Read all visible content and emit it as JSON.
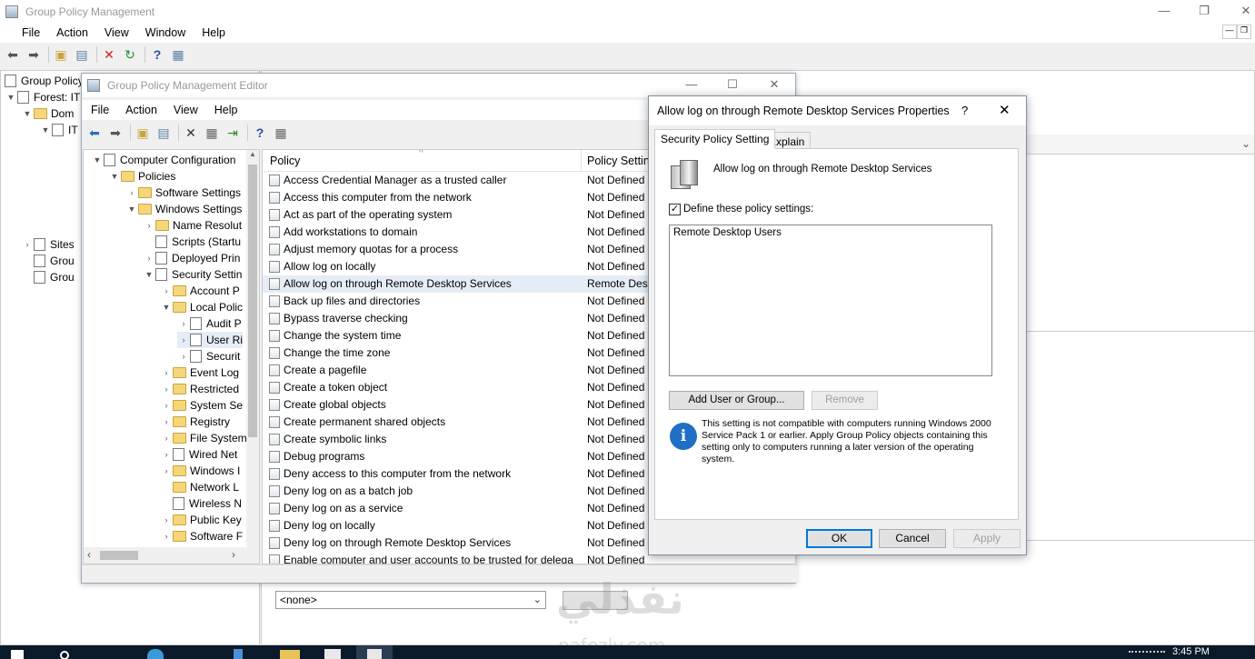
{
  "gpm": {
    "title": "Group Policy Management",
    "menu": [
      "File",
      "Action",
      "View",
      "Window",
      "Help"
    ],
    "tree": [
      "Group Policy",
      "Forest: IT",
      "Dom",
      "IT",
      "Sites",
      "Grou",
      "Grou"
    ]
  },
  "editor": {
    "title": "Group Policy Management Editor",
    "menu": [
      "File",
      "Action",
      "View",
      "Help"
    ],
    "tree": [
      {
        "label": "Computer Configuration",
        "indent": 0,
        "arrow": "▼",
        "kind": "doc"
      },
      {
        "label": "Policies",
        "indent": 1,
        "arrow": "▼",
        "kind": "fold"
      },
      {
        "label": "Software Settings",
        "indent": 2,
        "arrow": "›",
        "kind": "fold"
      },
      {
        "label": "Windows Settings",
        "indent": 2,
        "arrow": "▼",
        "kind": "fold"
      },
      {
        "label": "Name Resolut",
        "indent": 3,
        "arrow": "›",
        "kind": "fold"
      },
      {
        "label": "Scripts (Startu",
        "indent": 3,
        "arrow": "",
        "kind": "doc"
      },
      {
        "label": "Deployed Prin",
        "indent": 3,
        "arrow": "›",
        "kind": "doc"
      },
      {
        "label": "Security Settin",
        "indent": 3,
        "arrow": "▼",
        "kind": "doc"
      },
      {
        "label": "Account P",
        "indent": 4,
        "arrow": "›",
        "kind": "fold"
      },
      {
        "label": "Local Polic",
        "indent": 4,
        "arrow": "▼",
        "kind": "fold"
      },
      {
        "label": "Audit P",
        "indent": 5,
        "arrow": "›",
        "kind": "doc"
      },
      {
        "label": "User Ri",
        "indent": 5,
        "arrow": "›",
        "kind": "doc",
        "selected": true
      },
      {
        "label": "Securit",
        "indent": 5,
        "arrow": "›",
        "kind": "doc"
      },
      {
        "label": "Event Log",
        "indent": 4,
        "arrow": "›",
        "kind": "fold"
      },
      {
        "label": "Restricted",
        "indent": 4,
        "arrow": "›",
        "kind": "fold"
      },
      {
        "label": "System Se",
        "indent": 4,
        "arrow": "›",
        "kind": "fold"
      },
      {
        "label": "Registry",
        "indent": 4,
        "arrow": "›",
        "kind": "fold"
      },
      {
        "label": "File System",
        "indent": 4,
        "arrow": "›",
        "kind": "fold"
      },
      {
        "label": "Wired Net",
        "indent": 4,
        "arrow": "›",
        "kind": "doc"
      },
      {
        "label": "Windows I",
        "indent": 4,
        "arrow": "›",
        "kind": "fold"
      },
      {
        "label": "Network L",
        "indent": 4,
        "arrow": "",
        "kind": "fold"
      },
      {
        "label": "Wireless N",
        "indent": 4,
        "arrow": "",
        "kind": "doc"
      },
      {
        "label": "Public Key",
        "indent": 4,
        "arrow": "›",
        "kind": "fold"
      },
      {
        "label": "Software F",
        "indent": 4,
        "arrow": "›",
        "kind": "fold"
      }
    ],
    "columns": {
      "policy": "Policy",
      "setting": "Policy Setting"
    },
    "policies": [
      {
        "name": "Access Credential Manager as a trusted caller",
        "setting": "Not Defined"
      },
      {
        "name": "Access this computer from the network",
        "setting": "Not Defined"
      },
      {
        "name": "Act as part of the operating system",
        "setting": "Not Defined"
      },
      {
        "name": "Add workstations to domain",
        "setting": "Not Defined"
      },
      {
        "name": "Adjust memory quotas for a process",
        "setting": "Not Defined"
      },
      {
        "name": "Allow log on locally",
        "setting": "Not Defined"
      },
      {
        "name": "Allow log on through Remote Desktop Services",
        "setting": "Remote Desk",
        "selected": true
      },
      {
        "name": "Back up files and directories",
        "setting": "Not Defined"
      },
      {
        "name": "Bypass traverse checking",
        "setting": "Not Defined"
      },
      {
        "name": "Change the system time",
        "setting": "Not Defined"
      },
      {
        "name": "Change the time zone",
        "setting": "Not Defined"
      },
      {
        "name": "Create a pagefile",
        "setting": "Not Defined"
      },
      {
        "name": "Create a token object",
        "setting": "Not Defined"
      },
      {
        "name": "Create global objects",
        "setting": "Not Defined"
      },
      {
        "name": "Create permanent shared objects",
        "setting": "Not Defined"
      },
      {
        "name": "Create symbolic links",
        "setting": "Not Defined"
      },
      {
        "name": "Debug programs",
        "setting": "Not Defined"
      },
      {
        "name": "Deny access to this computer from the network",
        "setting": "Not Defined"
      },
      {
        "name": "Deny log on as a batch job",
        "setting": "Not Defined"
      },
      {
        "name": "Deny log on as a service",
        "setting": "Not Defined"
      },
      {
        "name": "Deny log on locally",
        "setting": "Not Defined"
      },
      {
        "name": "Deny log on through Remote Desktop Services",
        "setting": "Not Defined"
      },
      {
        "name": "Enable computer and user accounts to be trusted for delega",
        "setting": "Not Defined"
      }
    ]
  },
  "dialog": {
    "title": "Allow log on through Remote Desktop Services Properties",
    "help": "?",
    "tabs": [
      "Security Policy Setting",
      "Explain"
    ],
    "policy_name": "Allow log on through Remote Desktop Services",
    "define_label": "Define these policy settings:",
    "define_checked": true,
    "members": [
      "Remote Desktop Users"
    ],
    "add_button": "Add User or Group...",
    "remove_button": "Remove",
    "info_text": "This setting is not compatible with computers running Windows 2000 Service Pack 1 or earlier.  Apply Group Policy objects containing this setting only to computers running a later version of the operating system.",
    "ok": "OK",
    "cancel": "Cancel",
    "apply": "Apply"
  },
  "bottom": {
    "filter_value": "<none>"
  },
  "taskbar": {
    "clock": "3:45 PM"
  },
  "watermark": {
    "arabic": "نفذلي",
    "latin": "nafezly.com"
  }
}
